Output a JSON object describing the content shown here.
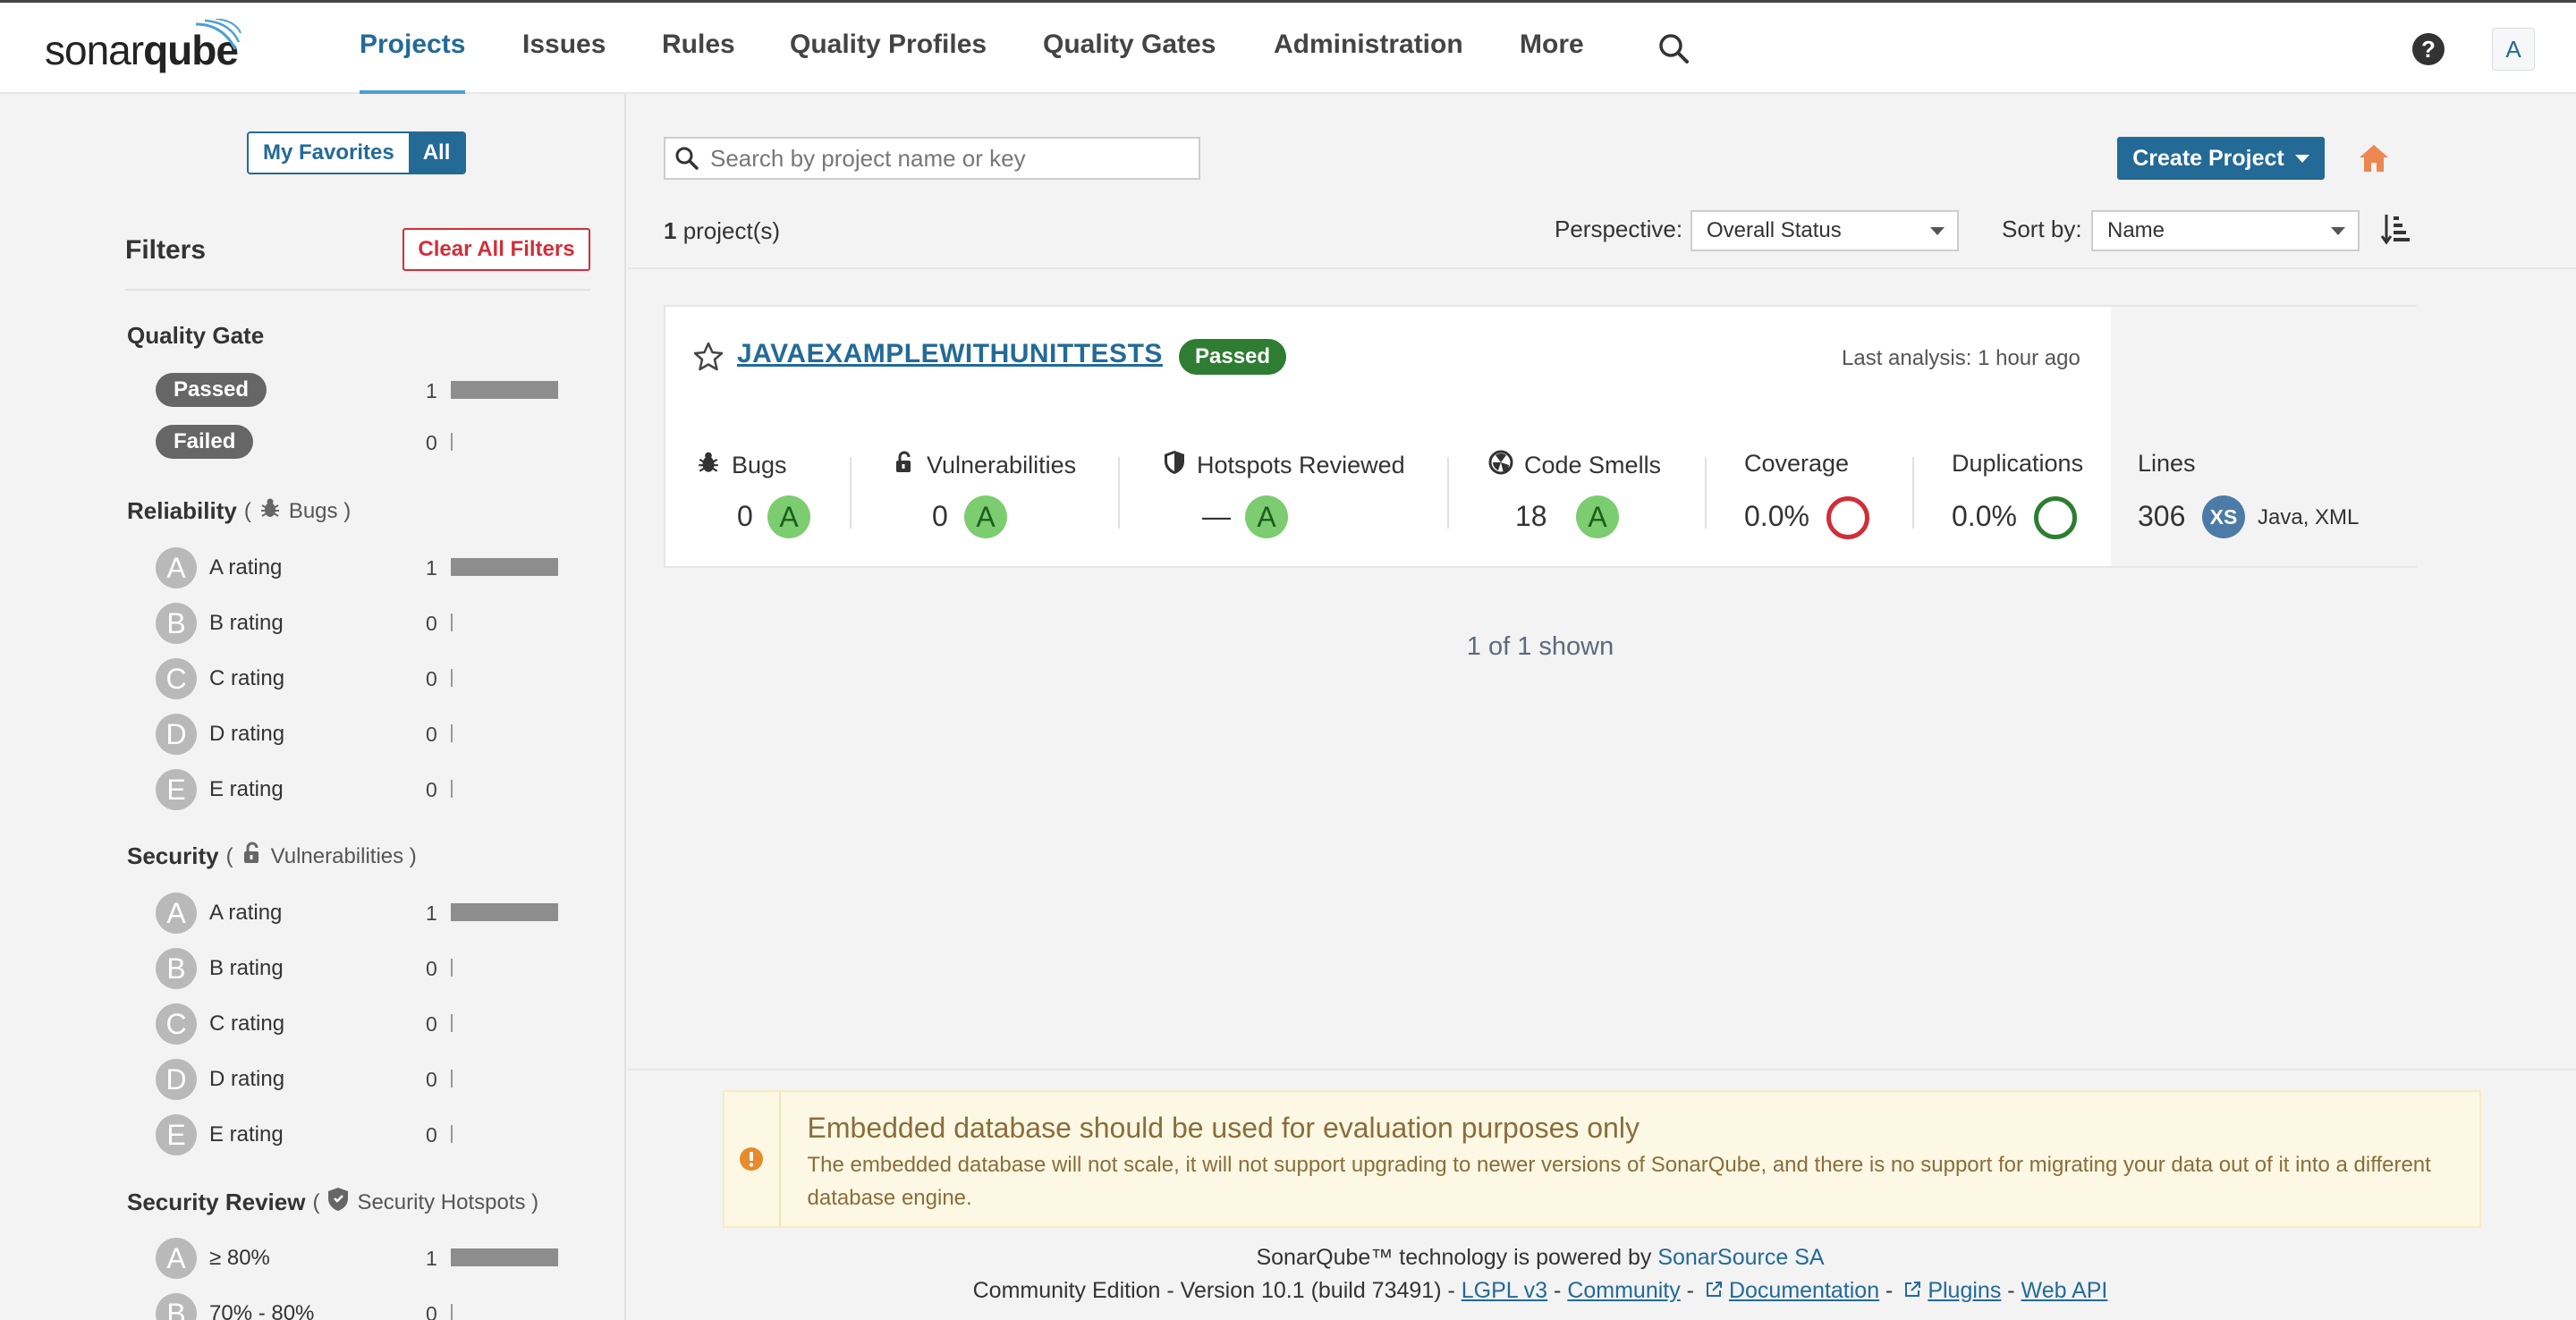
{
  "nav": {
    "logo_light": "sonar",
    "logo_bold": "qube",
    "items": [
      "Projects",
      "Issues",
      "Rules",
      "Quality Profiles",
      "Quality Gates",
      "Administration",
      "More"
    ],
    "active": "Projects",
    "help_icon": "?",
    "avatar_letter": "A"
  },
  "sidebar": {
    "favorites_label": "My Favorites",
    "all_label": "All",
    "filters_title": "Filters",
    "clear_label": "Clear All Filters",
    "quality_gate": {
      "title": "Quality Gate",
      "rows": [
        {
          "label": "Passed",
          "count": "1",
          "fraction": 1
        },
        {
          "label": "Failed",
          "count": "0",
          "fraction": 0
        }
      ]
    },
    "reliability": {
      "title": "Reliability",
      "sub": "Bugs",
      "rows": [
        {
          "letter": "A",
          "label": "A rating",
          "count": "1",
          "fraction": 1
        },
        {
          "letter": "B",
          "label": "B rating",
          "count": "0",
          "fraction": 0
        },
        {
          "letter": "C",
          "label": "C rating",
          "count": "0",
          "fraction": 0
        },
        {
          "letter": "D",
          "label": "D rating",
          "count": "0",
          "fraction": 0
        },
        {
          "letter": "E",
          "label": "E rating",
          "count": "0",
          "fraction": 0
        }
      ]
    },
    "security": {
      "title": "Security",
      "sub": "Vulnerabilities",
      "rows": [
        {
          "letter": "A",
          "label": "A rating",
          "count": "1",
          "fraction": 1
        },
        {
          "letter": "B",
          "label": "B rating",
          "count": "0",
          "fraction": 0
        },
        {
          "letter": "C",
          "label": "C rating",
          "count": "0",
          "fraction": 0
        },
        {
          "letter": "D",
          "label": "D rating",
          "count": "0",
          "fraction": 0
        },
        {
          "letter": "E",
          "label": "E rating",
          "count": "0",
          "fraction": 0
        }
      ]
    },
    "security_review": {
      "title": "Security Review",
      "sub": "Security Hotspots",
      "rows": [
        {
          "letter": "A",
          "label": "≥ 80%",
          "count": "1",
          "fraction": 1
        },
        {
          "letter": "B",
          "label": "70% - 80%",
          "count": "0",
          "fraction": 0
        }
      ]
    }
  },
  "main": {
    "search_placeholder": "Search by project name or key",
    "create_label": "Create Project",
    "project_count": "1",
    "project_count_suffix": " project(s)",
    "perspective_label": "Perspective:",
    "perspective_value": "Overall Status",
    "sort_label": "Sort by:",
    "sort_value": "Name",
    "shown_text": "1 of 1 shown"
  },
  "project": {
    "name": "JAVAEXAMPLEWITHUNITTESTS",
    "status": "Passed",
    "last_analysis": "Last analysis: 1 hour ago",
    "metrics": {
      "bugs": {
        "label": "Bugs",
        "value": "0",
        "rating": "A"
      },
      "vulnerabilities": {
        "label": "Vulnerabilities",
        "value": "0",
        "rating": "A"
      },
      "hotspots": {
        "label": "Hotspots Reviewed",
        "value": "—",
        "rating": "A"
      },
      "smells": {
        "label": "Code Smells",
        "value": "18",
        "rating": "A"
      },
      "coverage": {
        "label": "Coverage",
        "value": "0.0%"
      },
      "duplications": {
        "label": "Duplications",
        "value": "0.0%"
      },
      "lines": {
        "label": "Lines",
        "value": "306",
        "size": "XS",
        "languages": "Java, XML"
      }
    }
  },
  "alert": {
    "title": "Embedded database should be used for evaluation purposes only",
    "text": "The embedded database will not scale, it will not support upgrading to newer versions of SonarQube, and there is no support for migrating your data out of it into a different database engine."
  },
  "footer": {
    "powered_prefix": "SonarQube™ technology is powered by ",
    "powered_link": "SonarSource SA",
    "edition": "Community Edition - Version 10.1 (build 73491) - ",
    "links": [
      "LGPL v3",
      "Community",
      "Documentation",
      "Plugins",
      "Web API"
    ],
    "sep": " - "
  },
  "colors": {
    "brand": "#236a97",
    "passed": "#2e7d32",
    "rating_a": "#7ccd6f",
    "coverage_ring": "#d02f3a",
    "duplication_ring": "#2e7d32",
    "size_badge": "#4b7ba6",
    "clear_red": "#d02f3a",
    "home_icon": "#ec8751"
  }
}
